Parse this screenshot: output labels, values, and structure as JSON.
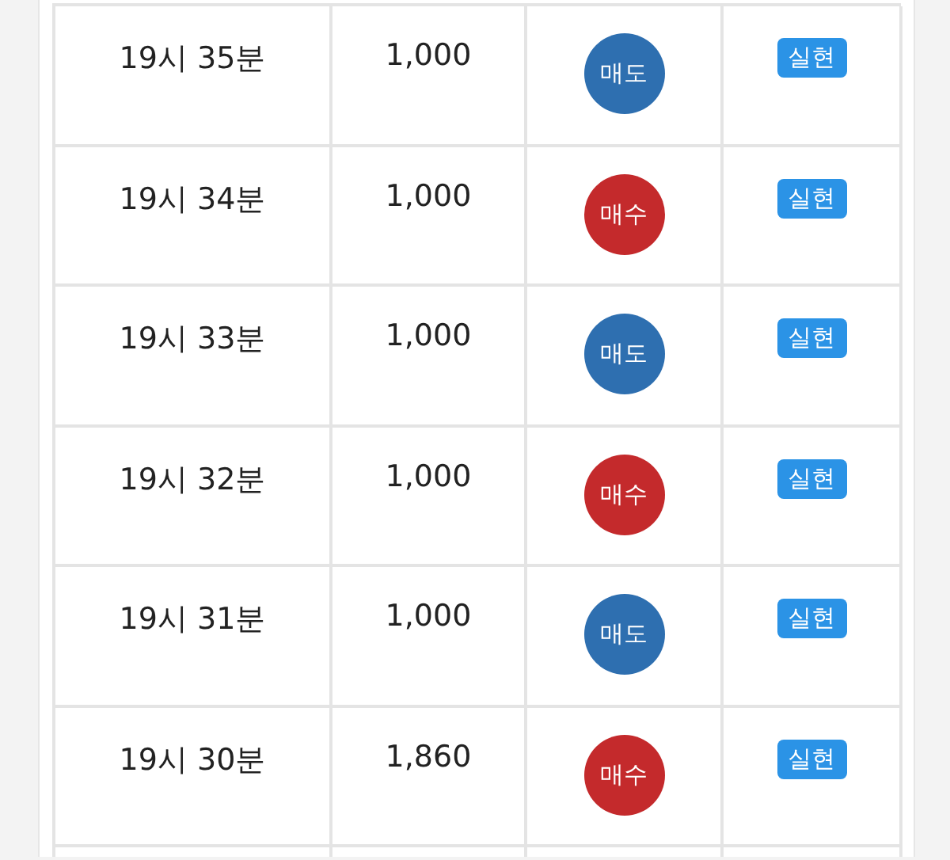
{
  "rows": [
    {
      "time": "19시 35분",
      "amount": "1,000",
      "side": {
        "label": "매도",
        "color": "#2e6fb0"
      },
      "status": "실현"
    },
    {
      "time": "19시 34분",
      "amount": "1,000",
      "side": {
        "label": "매수",
        "color": "#c42a2c"
      },
      "status": "실현"
    },
    {
      "time": "19시 33분",
      "amount": "1,000",
      "side": {
        "label": "매도",
        "color": "#2e6fb0"
      },
      "status": "실현"
    },
    {
      "time": "19시 32분",
      "amount": "1,000",
      "side": {
        "label": "매수",
        "color": "#c42a2c"
      },
      "status": "실현"
    },
    {
      "time": "19시 31분",
      "amount": "1,000",
      "side": {
        "label": "매도",
        "color": "#2e6fb0"
      },
      "status": "실현"
    },
    {
      "time": "19시 30분",
      "amount": "1,860",
      "side": {
        "label": "매수",
        "color": "#c42a2c"
      },
      "status": "실현"
    }
  ]
}
